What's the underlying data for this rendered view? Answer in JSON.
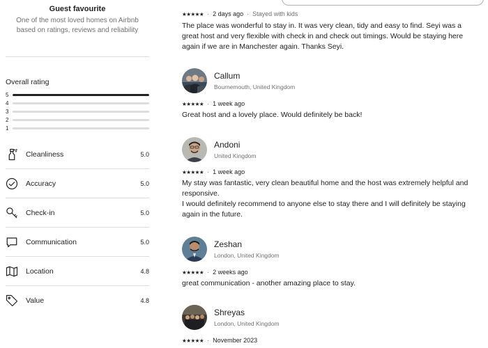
{
  "guest_favourite": {
    "title": "Guest favourite",
    "subtitle_line1": "One of the most loved homes on Airbnb",
    "subtitle_line2": "based on ratings, reviews and reliability"
  },
  "overall_rating": {
    "title": "Overall rating",
    "bars": [
      {
        "label": "5",
        "fraction": 1.0
      },
      {
        "label": "4",
        "fraction": 0.0
      },
      {
        "label": "3",
        "fraction": 0.0
      },
      {
        "label": "2",
        "fraction": 0.0
      },
      {
        "label": "1",
        "fraction": 0.0
      }
    ]
  },
  "categories": [
    {
      "label": "Cleanliness",
      "score": "5.0",
      "icon": "spray-bottle-icon"
    },
    {
      "label": "Accuracy",
      "score": "5.0",
      "icon": "check-circle-icon"
    },
    {
      "label": "Check-in",
      "score": "5.0",
      "icon": "key-icon"
    },
    {
      "label": "Communication",
      "score": "5.0",
      "icon": "message-bubble-icon"
    },
    {
      "label": "Location",
      "score": "4.8",
      "icon": "map-icon"
    },
    {
      "label": "Value",
      "score": "4.8",
      "icon": "tag-icon"
    }
  ],
  "reviews": [
    {
      "name": "",
      "location": "",
      "stars": "★★★★★",
      "date": "2 days ago",
      "extra": "Stayed with kids",
      "text_lines": [
        "The place was wonderful to stay in. It was very clean, tidy and easy to find. Seyi was a",
        "great host and very flexible with check in and check out timings. Would be staying here",
        "again if we are in Manchester again. Thanks Seyi."
      ]
    },
    {
      "name": "Callum",
      "location": "Bournemouth, United Kingdom",
      "stars": "★★★★★",
      "date": "1 week ago",
      "text_lines": [
        "Great host and a lovely place. Would definitely be back!"
      ]
    },
    {
      "name": "Andoni",
      "location": "United Kingdom",
      "stars": "★★★★★",
      "date": "1 week ago",
      "text_lines": [
        "My stay was fantastic, very clean beautiful home and the host was extremely helpful and",
        "responsive.",
        "I would definitely recommend to anyone else to stay there and I will definitely be staying",
        "again in the future."
      ]
    },
    {
      "name": "Zeshan",
      "location": "London, United Kingdom",
      "stars": "★★★★★",
      "date": "2 weeks ago",
      "text_lines": [
        "great communication - another amazing place to stay."
      ]
    },
    {
      "name": "Shreyas",
      "location": "London, United Kingdom",
      "stars": "★★★★★",
      "date": "November 2023",
      "text_lines": []
    }
  ],
  "separator": "·"
}
